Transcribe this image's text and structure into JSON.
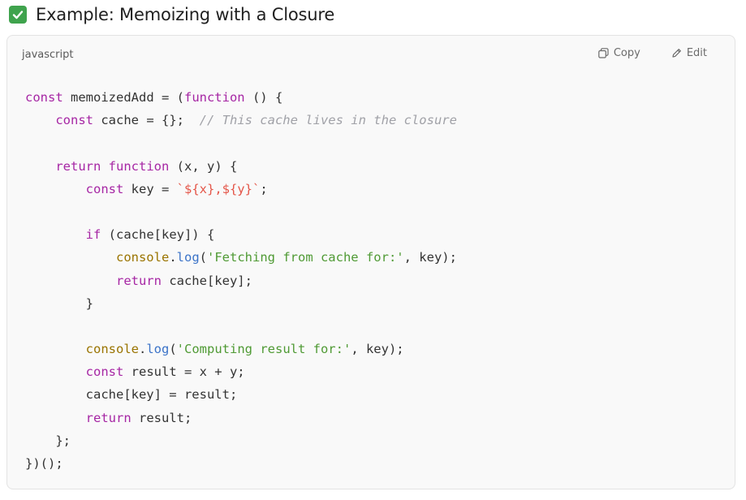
{
  "heading": {
    "text": "Example: Memoizing with a Closure"
  },
  "code_block": {
    "language": "javascript",
    "copy_label": "Copy",
    "edit_label": "Edit",
    "lines": [
      [
        [
          "kw",
          "const"
        ],
        [
          "plain",
          " memoizedAdd = ("
        ],
        [
          "kw",
          "function"
        ],
        [
          "plain",
          " () {"
        ]
      ],
      [
        [
          "plain",
          "    "
        ],
        [
          "kw",
          "const"
        ],
        [
          "plain",
          " cache = {};  "
        ],
        [
          "cm",
          "// This cache lives in the closure"
        ]
      ],
      [],
      [
        [
          "plain",
          "    "
        ],
        [
          "kw",
          "return"
        ],
        [
          "plain",
          " "
        ],
        [
          "kw",
          "function"
        ],
        [
          "plain",
          " (x, y) {"
        ]
      ],
      [
        [
          "plain",
          "        "
        ],
        [
          "kw",
          "const"
        ],
        [
          "plain",
          " key = "
        ],
        [
          "tmpl",
          "`${x},${y}`"
        ],
        [
          "plain",
          ";"
        ]
      ],
      [],
      [
        [
          "plain",
          "        "
        ],
        [
          "kw",
          "if"
        ],
        [
          "plain",
          " (cache[key]) {"
        ]
      ],
      [
        [
          "plain",
          "            "
        ],
        [
          "obj",
          "console"
        ],
        [
          "plain",
          "."
        ],
        [
          "fn",
          "log"
        ],
        [
          "plain",
          "("
        ],
        [
          "str",
          "'Fetching from cache for:'"
        ],
        [
          "plain",
          ", key);"
        ]
      ],
      [
        [
          "plain",
          "            "
        ],
        [
          "kw",
          "return"
        ],
        [
          "plain",
          " cache[key];"
        ]
      ],
      [
        [
          "plain",
          "        }"
        ]
      ],
      [],
      [
        [
          "plain",
          "        "
        ],
        [
          "obj",
          "console"
        ],
        [
          "plain",
          "."
        ],
        [
          "fn",
          "log"
        ],
        [
          "plain",
          "("
        ],
        [
          "str",
          "'Computing result for:'"
        ],
        [
          "plain",
          ", key);"
        ]
      ],
      [
        [
          "plain",
          "        "
        ],
        [
          "kw",
          "const"
        ],
        [
          "plain",
          " result = x + y;"
        ]
      ],
      [
        [
          "plain",
          "        cache[key] = result;"
        ]
      ],
      [
        [
          "plain",
          "        "
        ],
        [
          "kw",
          "return"
        ],
        [
          "plain",
          " result;"
        ]
      ],
      [
        [
          "plain",
          "    };"
        ]
      ],
      [
        [
          "plain",
          "})();"
        ]
      ]
    ]
  },
  "colors": {
    "keyword": "#a626a4",
    "function": "#3b73c8",
    "string": "#4f9a34",
    "object": "#9a7400",
    "comment": "#a0a1a7",
    "template": "#e45649",
    "check": "#3fa34d"
  },
  "icons": {
    "heading": "check-mark-icon",
    "copy": "copy-icon",
    "edit": "edit-icon"
  }
}
